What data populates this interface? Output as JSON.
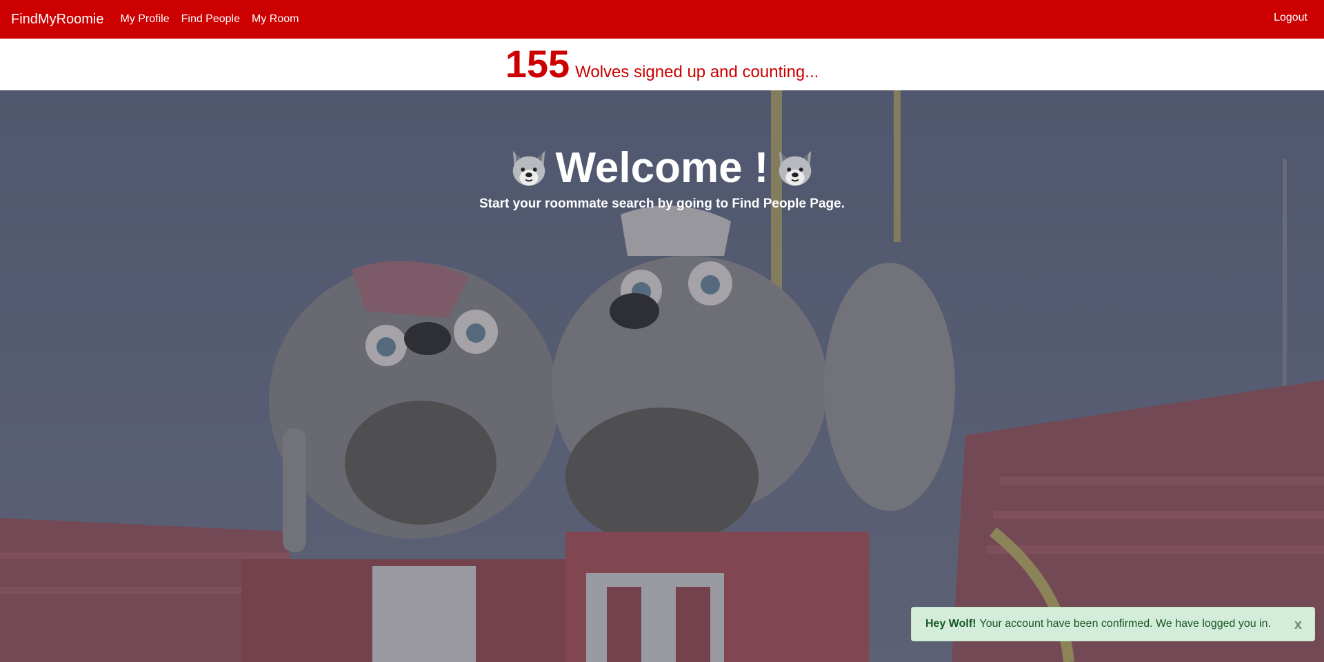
{
  "nav": {
    "brand": "FindMyRoomie",
    "links": [
      "My Profile",
      "Find People",
      "My Room"
    ],
    "logout": "Logout"
  },
  "counter": {
    "count": "155",
    "text": "Wolves signed up and counting..."
  },
  "hero": {
    "title": "Welcome !",
    "subtitle": "Start your roommate search by going to Find People Page.",
    "left_icon": "wolf-icon",
    "right_icon": "wolf-icon"
  },
  "alert": {
    "strong": "Hey Wolf!",
    "message": "Your account have been confirmed. We have logged you in.",
    "close": "x"
  },
  "colors": {
    "brand_red": "#cc0000",
    "alert_bg": "#d4edda",
    "alert_text": "#155724"
  }
}
